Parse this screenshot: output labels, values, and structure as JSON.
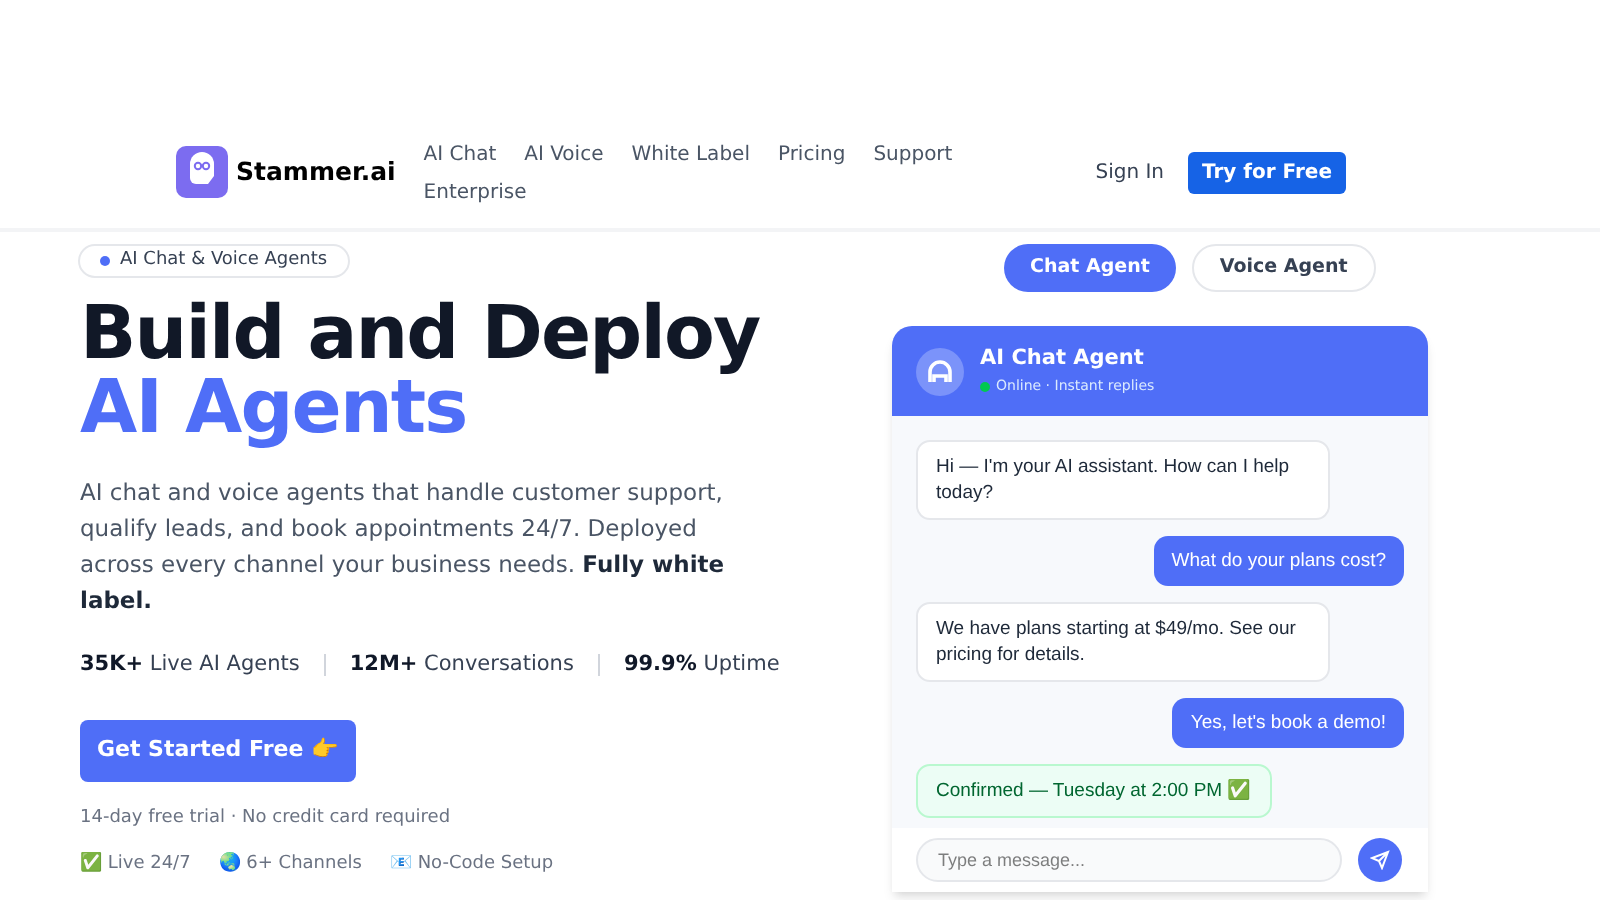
{
  "brand": {
    "name": "Stammer.ai"
  },
  "nav": {
    "links": [
      "AI Chat",
      "AI Voice",
      "White Label",
      "Pricing",
      "Support",
      "Enterprise"
    ],
    "sign_in": "Sign In",
    "cta": "Try for Free"
  },
  "hero": {
    "badge": "AI Chat & Voice Agents",
    "title_line_1": "Build and Deploy",
    "title_line_2": "AI Agents",
    "description": "AI chat and voice agents that handle customer support, qualify leads, and book appointments 24/7. Deployed across every channel your business needs. **Fully white label.**",
    "stats": [
      {
        "value": "35K+",
        "label": "Live AI Agents"
      },
      {
        "value": "12M+",
        "label": "Conversations"
      },
      {
        "value": "99.9%",
        "label": "Uptime"
      }
    ],
    "cta": "Get Started Free 👉",
    "note": "14-day free trial · No credit card required",
    "features": [
      "✅ Live 24/7",
      "🌏 6+ Channels",
      "📧 No-Code Setup"
    ]
  },
  "agent_tabs": [
    {
      "label": "Chat Agent",
      "selected": true
    },
    {
      "label": "Voice Agent",
      "selected": false
    }
  ],
  "chat": {
    "title": "AI Chat Agent",
    "status": "Online · Instant replies",
    "online": true,
    "messages": [
      {
        "kind": "agent",
        "text": "Hi — I'm your AI assistant. How can I help today?"
      },
      {
        "kind": "user",
        "text": "What do your plans cost?"
      },
      {
        "kind": "agent",
        "text": "We have plans starting at $49/mo. See our pricing for details."
      },
      {
        "kind": "user",
        "text": "Yes, let's book a demo!"
      },
      {
        "kind": "confirmation",
        "text": "Confirmed — Tuesday at 2:00 PM ✅"
      }
    ],
    "input": {
      "placeholder": "Type a message..."
    }
  }
}
